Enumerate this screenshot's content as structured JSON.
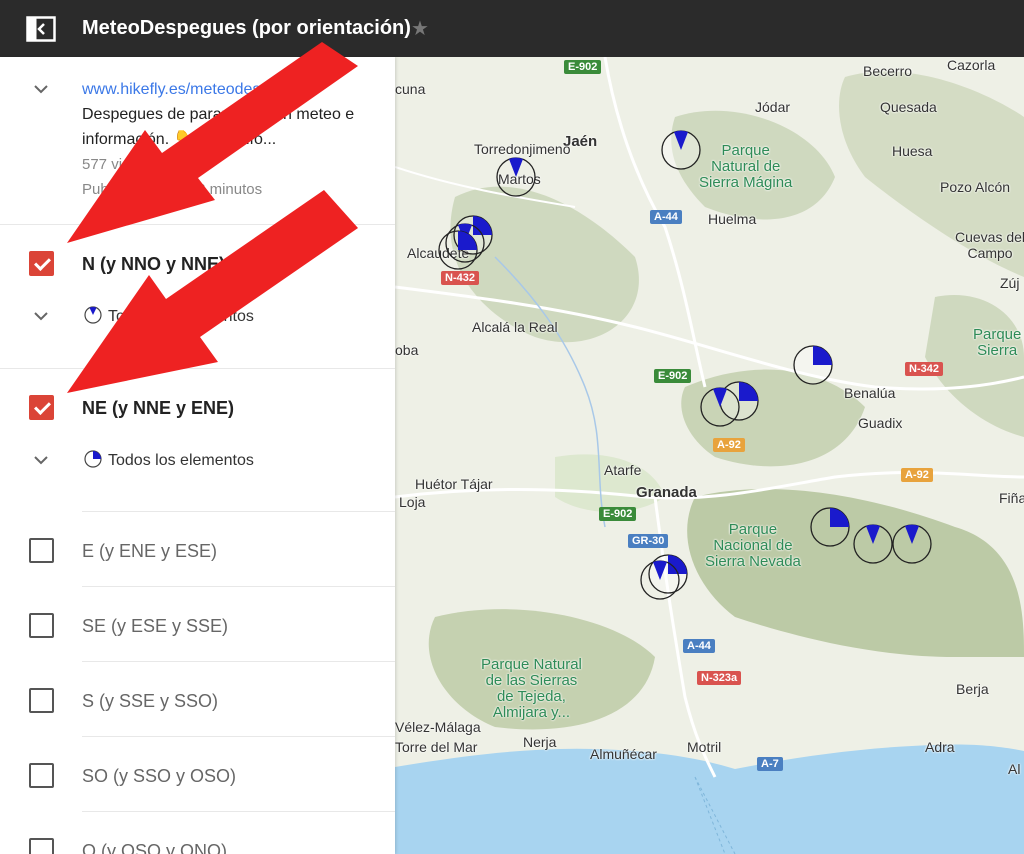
{
  "app": {
    "title": "MeteoDespegues (por orientación)",
    "star_glyph": "★"
  },
  "description": {
    "link": "www.hikefly.es/meteodespegues",
    "text": "Despegues de parapente con meteo e información. 👇 Click info...",
    "views": "577 vistas",
    "published": "Publicado hace 13 minutos"
  },
  "layers": [
    {
      "name": "N (y NNO y NNE)",
      "checked": true,
      "sub": "Todos los elementos"
    },
    {
      "name": "NE (y NNE y ENE)",
      "checked": true,
      "sub": "Todos los elementos"
    },
    {
      "name": "E (y ENE y ESE)",
      "checked": false
    },
    {
      "name": "SE (y ESE y SSE)",
      "checked": false
    },
    {
      "name": "S (y SSE y SSO)",
      "checked": false
    },
    {
      "name": "SO (y SSO y OSO)",
      "checked": false
    },
    {
      "name": "O (y OSO y ONO)",
      "checked": false
    }
  ],
  "map": {
    "places": {
      "cuna": "cuna",
      "jaen": "Jaén",
      "torredonjimeno": "Torredonjimeno",
      "martos": "Martos",
      "jodar": "Jódar",
      "quesada": "Quesada",
      "becerro": "Becerro",
      "cazorla": "Cazorla",
      "huesa": "Huesa",
      "pozo_alcon": "Pozo Alcón",
      "huelma": "Huelma",
      "cuevas": "Cuevas del\nCampo",
      "zuj": "Zúj",
      "alcaudete": "Alcaudete",
      "alcala": "Alcalá la Real",
      "oba": "oba",
      "benalua": "Benalúa",
      "guadix": "Guadix",
      "huetor": "Huétor Tájar",
      "loja": "Loja",
      "atarfe": "Atarfe",
      "granada": "Granada",
      "fina": "Fiña",
      "berja": "Berja",
      "velez": "Vélez-Málaga",
      "torre": "Torre del Mar",
      "nerja": "Nerja",
      "almunecar": "Almuñécar",
      "motril": "Motril",
      "adra": "Adra",
      "al": "Al"
    },
    "parks": {
      "magina": "Parque\nNatural de\nSierra Mágina",
      "nevada": "Parque\nNacional de\nSierra Nevada",
      "tejeda": "Parque Natural\nde las Sierras\nde Tejeda,\nAlmijara y...",
      "parque_right": "Parque\nSierra"
    },
    "roads": {
      "e902_top": "E-902",
      "a44_top": "A-44",
      "n432": "N-432",
      "e902_mid": "E-902",
      "n342": "N-342",
      "a92_mid": "A-92",
      "a92_right": "A-92",
      "e902_low": "E-902",
      "gr30": "GR-30",
      "a44_low": "A-44",
      "n323a": "N-323a",
      "a7": "A-7"
    },
    "colors": {
      "water": "#a8d4f0",
      "land": "#eef0e6",
      "mountain": "#cfd9bf",
      "marker": "#1a1acc"
    }
  }
}
